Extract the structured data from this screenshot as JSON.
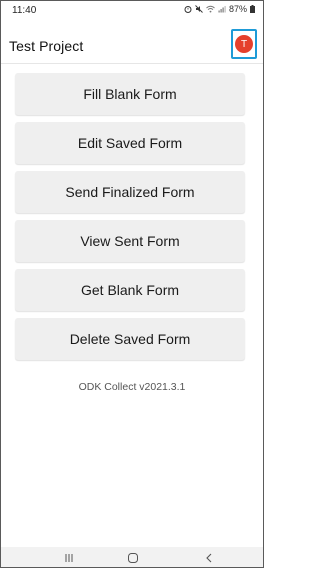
{
  "status_bar": {
    "time": "11:40",
    "battery": "87%",
    "icons": [
      "alarm-icon",
      "mute-icon",
      "wifi-icon",
      "signal-icon",
      "battery-icon"
    ]
  },
  "app_bar": {
    "title": "Test Project",
    "avatar_letter": "T",
    "avatar_color": "#e5402c",
    "highlight_color": "#1e9bd7"
  },
  "menu": {
    "items": [
      {
        "label": "Fill Blank Form"
      },
      {
        "label": "Edit Saved Form"
      },
      {
        "label": "Send Finalized Form"
      },
      {
        "label": "View Sent Form"
      },
      {
        "label": "Get Blank Form"
      },
      {
        "label": "Delete Saved Form"
      }
    ]
  },
  "footer": {
    "version": "ODK Collect v2021.3.1"
  },
  "nav_bar": {
    "icons": [
      "recent-apps-icon",
      "home-icon",
      "back-icon"
    ]
  }
}
